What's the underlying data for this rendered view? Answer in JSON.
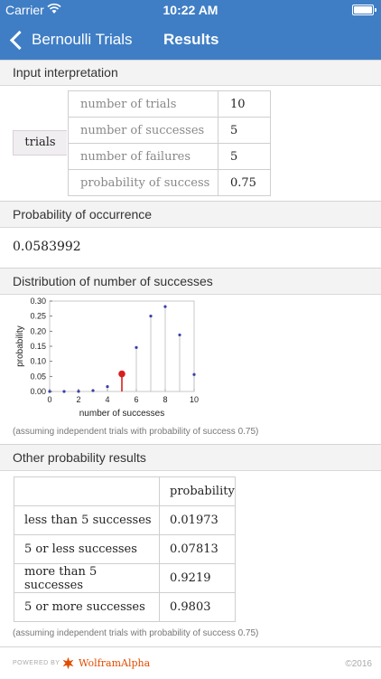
{
  "status": {
    "carrier": "Carrier",
    "time": "10:22 AM"
  },
  "nav": {
    "back_label": "Bernoulli Trials",
    "title": "Results"
  },
  "input_interpretation": {
    "header": "Input interpretation",
    "category": "trials",
    "rows": [
      {
        "label": "number of trials",
        "value": "10"
      },
      {
        "label": "number of successes",
        "value": "5"
      },
      {
        "label": "number of failures",
        "value": "5"
      },
      {
        "label": "probability of success",
        "value": "0.75"
      }
    ]
  },
  "probability_of_occurrence": {
    "header": "Probability of occurrence",
    "value": "0.0583992"
  },
  "distribution": {
    "header": "Distribution of number of successes",
    "assumption": "(assuming independent trials with probability of success 0.75)"
  },
  "chart_data": {
    "type": "scatter",
    "xlabel": "number of successes",
    "ylabel": "probability",
    "xlim": [
      0,
      10
    ],
    "ylim": [
      0,
      0.3
    ],
    "x_ticks": [
      "0",
      "2",
      "4",
      "6",
      "8",
      "10"
    ],
    "y_ticks": [
      "0.00",
      "0.05",
      "0.10",
      "0.15",
      "0.20",
      "0.25",
      "0.30"
    ],
    "x": [
      0,
      1,
      2,
      3,
      4,
      5,
      6,
      7,
      8,
      9,
      10
    ],
    "values": [
      1e-06,
      3e-05,
      0.0004,
      0.0031,
      0.0162,
      0.0584,
      0.146,
      0.2503,
      0.2816,
      0.1877,
      0.0563
    ],
    "highlight_x": 5,
    "colors": {
      "points": "#3b3fa6",
      "highlight": "#d81f1f",
      "stems": "#b9b9b9"
    }
  },
  "other_results": {
    "header": "Other probability results",
    "column_header": "probability",
    "rows": [
      {
        "label": "less than 5 successes",
        "value": "0.01973"
      },
      {
        "label": "5 or less successes",
        "value": "0.07813"
      },
      {
        "label": "more than 5 successes",
        "value": "0.9219"
      },
      {
        "label": "5 or more successes",
        "value": "0.9803"
      }
    ],
    "assumption": "(assuming independent trials with probability of success 0.75)"
  },
  "footer": {
    "powered_by": "POWERED BY",
    "brand": "WolframAlpha",
    "copyright": "©2016"
  }
}
